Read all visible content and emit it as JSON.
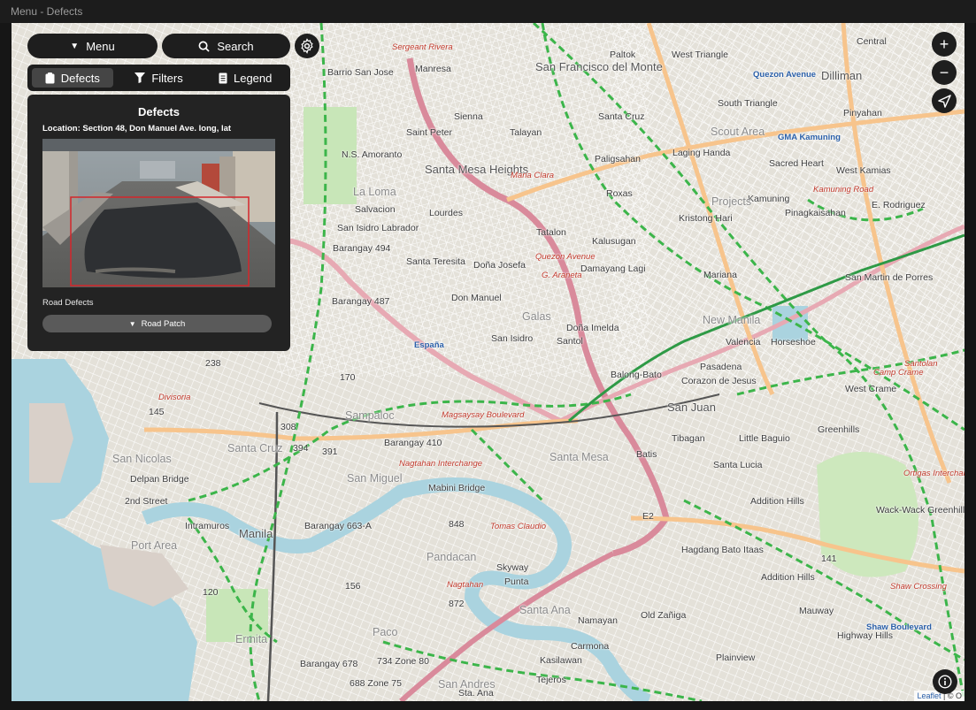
{
  "window": {
    "title": "Menu - Defects"
  },
  "toolbar": {
    "menu_label": "Menu",
    "search_label": "Search"
  },
  "tabs": {
    "defects": "Defects",
    "filters": "Filters",
    "legend": "Legend"
  },
  "panel": {
    "title": "Defects",
    "location": "Location: Section 48, Don Manuel Ave. long, lat",
    "category": "Road Defects",
    "selected_type": "Road Patch"
  },
  "map_controls": {
    "zoom_in": "+",
    "zoom_out": "−"
  },
  "attribution": {
    "leaflet": "Leaflet",
    "rest": "| © O"
  },
  "map_labels": [
    "Paltok",
    "West Triangle",
    "Quezon Avenue",
    "Dilliman",
    "Central",
    "Manresa",
    "San Francisco del Monte",
    "Barrio San Jose",
    "Sergeant Rivera",
    "South Triangle",
    "Pinyahan",
    "Sienna",
    "Santa Cruz",
    "Scout Area",
    "GMA Kamuning",
    "Saint Peter",
    "Talayan",
    "Laging Handa",
    "Sacred Heart",
    "West Kamias",
    "N.S. Amoranto",
    "Santa Mesa Heights",
    "Paligsahan",
    "La Loma",
    "Roxas",
    "Kamuning",
    "Projects",
    "Salvacion",
    "Lourdes",
    "Tatalon",
    "Kristong Hari",
    "Pinagkaisahan",
    "E. Rodriguez",
    "San Isidro Labrador",
    "Kalusugan",
    "Barangay 494",
    "Santa Teresita",
    "Doña Josefa",
    "Damayang Lagi",
    "San Martin de Porres",
    "Don Manuel",
    "Mariana",
    "Barangay 487",
    "Galas",
    "Doña Imelda",
    "New Manila",
    "Valencia",
    "Horseshoe",
    "San Isidro",
    "Santol",
    "Pasadena",
    "238",
    "Balong-Bato",
    "Corazon de Jesus",
    "West Crame",
    "Sampaloc",
    "San Juan",
    "308",
    "Barangay 410",
    "Tibagan",
    "Little Baguio",
    "Greenhills",
    "394",
    "391",
    "Batis",
    "Santa Cruz",
    "Santa Mesa",
    "Santa Lucia",
    "San Nicolas",
    "San Miguel",
    "Mabini Bridge",
    "Delpan Bridge",
    "2nd Street",
    "Addition Hills",
    "Wack-Wack Greenhills",
    "Intramuros",
    "Barangay 663-A",
    "848",
    "Manila",
    "Port Area",
    "Pandacan",
    "Hagdang Bato Itaas",
    "Addition Hills",
    "Punta",
    "Paco",
    "Santa Ana",
    "Old Zañiga",
    "Mauway",
    "Ermita",
    "Namayan",
    "Highway Hills",
    "Barangay 678",
    "734 Zone 80",
    "Carmona",
    "Plainview",
    "Kasilawan",
    "688 Zone 75",
    "San Andres",
    "Tejeros",
    "872",
    "Sta. Ana",
    "E2",
    "170",
    "145",
    "156",
    "120",
    "141"
  ],
  "road_labels": [
    "España",
    "Magsaysay Boulevard",
    "Nagtahan Interchange",
    "Tomas Claudio",
    "Nagtahan",
    "Quezon Avenue",
    "G. Araneta",
    "Ortigas Interchange",
    "Shaw Boulevard",
    "Kamuning Road",
    "Shaw Crossing",
    "Camp Crame",
    "Santolan",
    "Maria Clara",
    "Divisoria",
    "Skyway"
  ],
  "colors": {
    "accent": "#1e1e1e",
    "map_bg": "#ecebe6",
    "rail": "#3cb54a",
    "primary_road": "#e7a9b3"
  }
}
